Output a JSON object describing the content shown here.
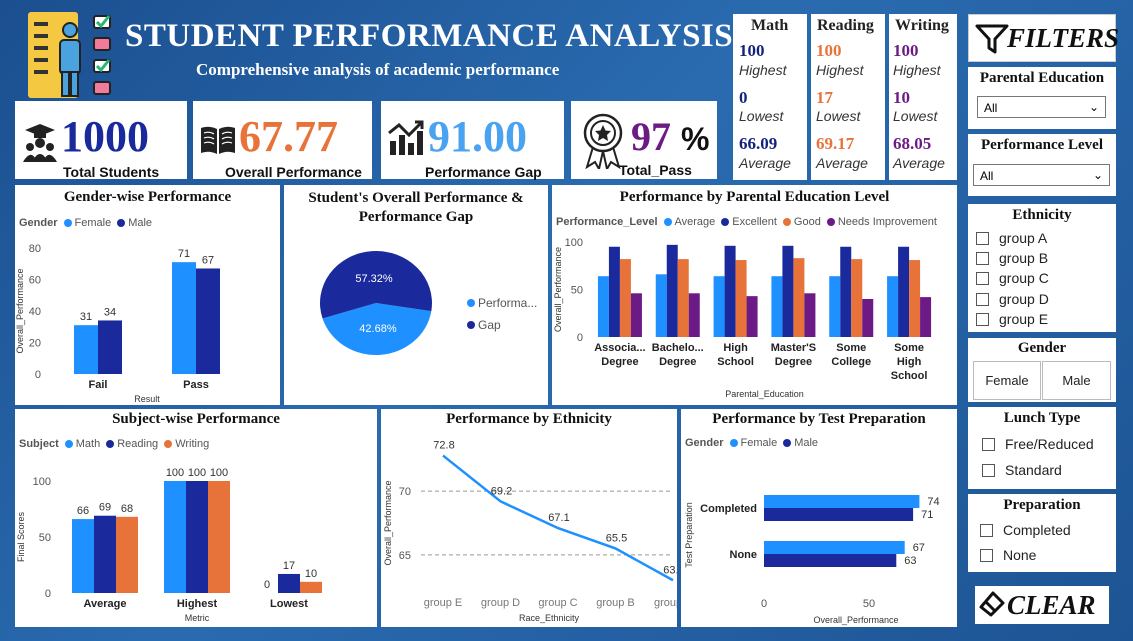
{
  "header": {
    "title": "STUDENT PERFORMANCE ANALYSIS",
    "subtitle": "Comprehensive analysis of academic performance"
  },
  "kpis": {
    "total_students": {
      "value": "1000",
      "label": "Total Students"
    },
    "overall_performance": {
      "value": "67.77",
      "label": "Overall Performance"
    },
    "performance_gap": {
      "value": "91.00",
      "label": "Performance Gap"
    },
    "total_pass": {
      "value": "97",
      "unit": "%",
      "label": "Total_Pass"
    }
  },
  "subjects": [
    {
      "name": "Math",
      "highest": "100",
      "lowest": "0",
      "average": "66.09",
      "color": "#14237a"
    },
    {
      "name": "Reading",
      "highest": "100",
      "lowest": "17",
      "average": "69.17",
      "color": "#e8733a"
    },
    {
      "name": "Writing",
      "highest": "100",
      "lowest": "10",
      "average": "68.05",
      "color": "#6b1a86"
    }
  ],
  "subject_labels": {
    "highest": "Highest",
    "lowest": "Lowest",
    "average": "Average"
  },
  "filters": {
    "title": "FILTERS",
    "parental_education": {
      "label": "Parental Education",
      "selected": "All"
    },
    "performance_level": {
      "label": "Performance Level",
      "selected": "All"
    },
    "ethnicity": {
      "label": "Ethnicity",
      "options": [
        "group A",
        "group B",
        "group C",
        "group D",
        "group E"
      ]
    },
    "gender": {
      "label": "Gender",
      "options": [
        "Female",
        "Male"
      ]
    },
    "lunch": {
      "label": "Lunch Type",
      "options": [
        "Free/Reduced",
        "Standard"
      ]
    },
    "preparation": {
      "label": "Preparation",
      "options": [
        "Completed",
        "None"
      ]
    },
    "clear_label": "CLEAR"
  },
  "colors": {
    "light_blue": "#1e90ff",
    "dark_blue": "#1a2a9c",
    "orange": "#e8733a",
    "purple": "#6b1a86",
    "line": "#1e90ff"
  },
  "chart_data": [
    {
      "id": "gender",
      "type": "bar",
      "title": "Gender-wise Performance",
      "legend_title": "Gender",
      "xlabel": "Result",
      "ylabel": "Overall_Performance",
      "categories": [
        "Fail",
        "Pass"
      ],
      "series": [
        {
          "name": "Female",
          "values": [
            31,
            71
          ]
        },
        {
          "name": "Male",
          "values": [
            34,
            67
          ]
        }
      ],
      "ylim": [
        0,
        80
      ],
      "yticks": [
        0,
        20,
        40,
        60,
        80
      ]
    },
    {
      "id": "overall_pie",
      "type": "pie",
      "title": "Student's Overall Performance & Performance Gap",
      "slices": [
        {
          "name": "Performa...",
          "value": 42.68,
          "label": "42.68%"
        },
        {
          "name": "Gap",
          "value": 57.32,
          "label": "57.32%"
        }
      ]
    },
    {
      "id": "parental",
      "type": "bar",
      "title": "Performance by Parental Education Level",
      "legend_title": "Performance_Level",
      "xlabel": "Parental_Education",
      "ylabel": "Overall_Performance",
      "categories": [
        [
          "Associa...",
          "Degree"
        ],
        [
          "Bachelo...",
          "Degree"
        ],
        [
          "High",
          "School"
        ],
        [
          "Master'S",
          "Degree"
        ],
        [
          "Some",
          "College"
        ],
        [
          "Some",
          "High",
          "School"
        ]
      ],
      "series": [
        {
          "name": "Average",
          "values": [
            64,
            66,
            64,
            64,
            64,
            64
          ]
        },
        {
          "name": "Excellent",
          "values": [
            95,
            97,
            96,
            96,
            95,
            95
          ]
        },
        {
          "name": "Good",
          "values": [
            82,
            82,
            81,
            83,
            82,
            81
          ]
        },
        {
          "name": "Needs Improvement",
          "values": [
            46,
            46,
            43,
            46,
            40,
            42
          ]
        }
      ],
      "ylim": [
        0,
        100
      ],
      "yticks": [
        0,
        50,
        100
      ]
    },
    {
      "id": "subject",
      "type": "bar",
      "title": "Subject-wise Performance",
      "legend_title": "Subject",
      "xlabel": "Metric",
      "ylabel": "Final Scores",
      "categories": [
        "Average",
        "Highest",
        "Lowest"
      ],
      "series": [
        {
          "name": "Math",
          "values": [
            66,
            100,
            0
          ]
        },
        {
          "name": "Reading",
          "values": [
            69,
            100,
            17
          ]
        },
        {
          "name": "Writing",
          "values": [
            68,
            100,
            10
          ]
        }
      ],
      "ylim": [
        0,
        100
      ],
      "yticks": [
        0,
        50,
        100
      ]
    },
    {
      "id": "ethnicity",
      "type": "line",
      "title": "Performance by Ethnicity",
      "xlabel": "Race_Ethnicity",
      "ylabel": "Overall_Performance",
      "categories": [
        "group E",
        "group D",
        "group C",
        "group B",
        "group A"
      ],
      "values": [
        72.8,
        69.2,
        67.1,
        65.5,
        63.0
      ],
      "labels": [
        "72.8",
        "69.2",
        "67.1",
        "65.5",
        "63.0"
      ],
      "yticks": [
        65,
        70
      ],
      "ylim": [
        62,
        73
      ]
    },
    {
      "id": "testprep",
      "type": "bar",
      "orientation": "horizontal",
      "title": "Performance by Test Preparation",
      "legend_title": "Gender",
      "xlabel": "Overall_Performance",
      "ylabel": "Test Preparation",
      "categories": [
        "Completed",
        "None"
      ],
      "series": [
        {
          "name": "Female",
          "values": [
            74,
            67
          ]
        },
        {
          "name": "Male",
          "values": [
            71,
            63
          ]
        }
      ],
      "xlim": [
        0,
        80
      ],
      "xticks": [
        0,
        50
      ]
    }
  ]
}
